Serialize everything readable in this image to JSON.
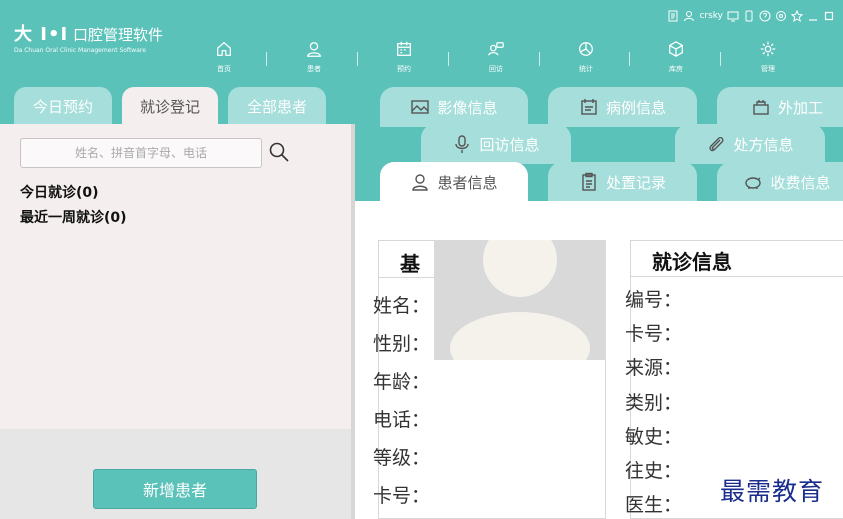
{
  "app": {
    "name_mark": "大 I•I",
    "name": "口腔管理软件",
    "name_en": "Da Chuan Oral Clinic Management Software"
  },
  "nav": [
    {
      "label": "首页",
      "icon": "home-icon"
    },
    {
      "label": "患者",
      "icon": "user-icon"
    },
    {
      "label": "预约",
      "icon": "calendar-icon"
    },
    {
      "label": "回访",
      "icon": "followup-icon"
    },
    {
      "label": "统计",
      "icon": "chart-icon"
    },
    {
      "label": "库房",
      "icon": "box-icon"
    },
    {
      "label": "管理",
      "icon": "gear-icon"
    }
  ],
  "status": {
    "username": "crsky"
  },
  "left_tabs": [
    {
      "label": "今日预约"
    },
    {
      "label": "就诊登记",
      "active": true
    },
    {
      "label": "全部患者"
    }
  ],
  "search": {
    "placeholder": "姓名、拼音首字母、电话"
  },
  "stats": {
    "today": "今日就诊(0)",
    "week": "最近一周就诊(0)"
  },
  "add_button": "新增患者",
  "right_tabs": {
    "row1": [
      "影像信息",
      "病例信息",
      "外加工"
    ],
    "row2": [
      "回访信息",
      "处方信息"
    ],
    "row3": [
      "患者信息",
      "处置记录",
      "收费信息"
    ],
    "active": "患者信息"
  },
  "basic_card": {
    "title": "基",
    "fields": [
      "姓名：",
      "性别：",
      "年龄：",
      "电话：",
      "等级：",
      "卡号："
    ]
  },
  "visit_card": {
    "title": "就诊信息",
    "fields": [
      "编号：",
      "卡号：",
      "来源：",
      "类别：",
      "敏史：",
      "往史：",
      "医生："
    ]
  },
  "watermark": "最需教育",
  "colors": {
    "primary": "#5bc2ba",
    "tab_inactive": "#a5deda",
    "panel_bg": "#f4efee",
    "watermark": "#1a2d8c"
  }
}
